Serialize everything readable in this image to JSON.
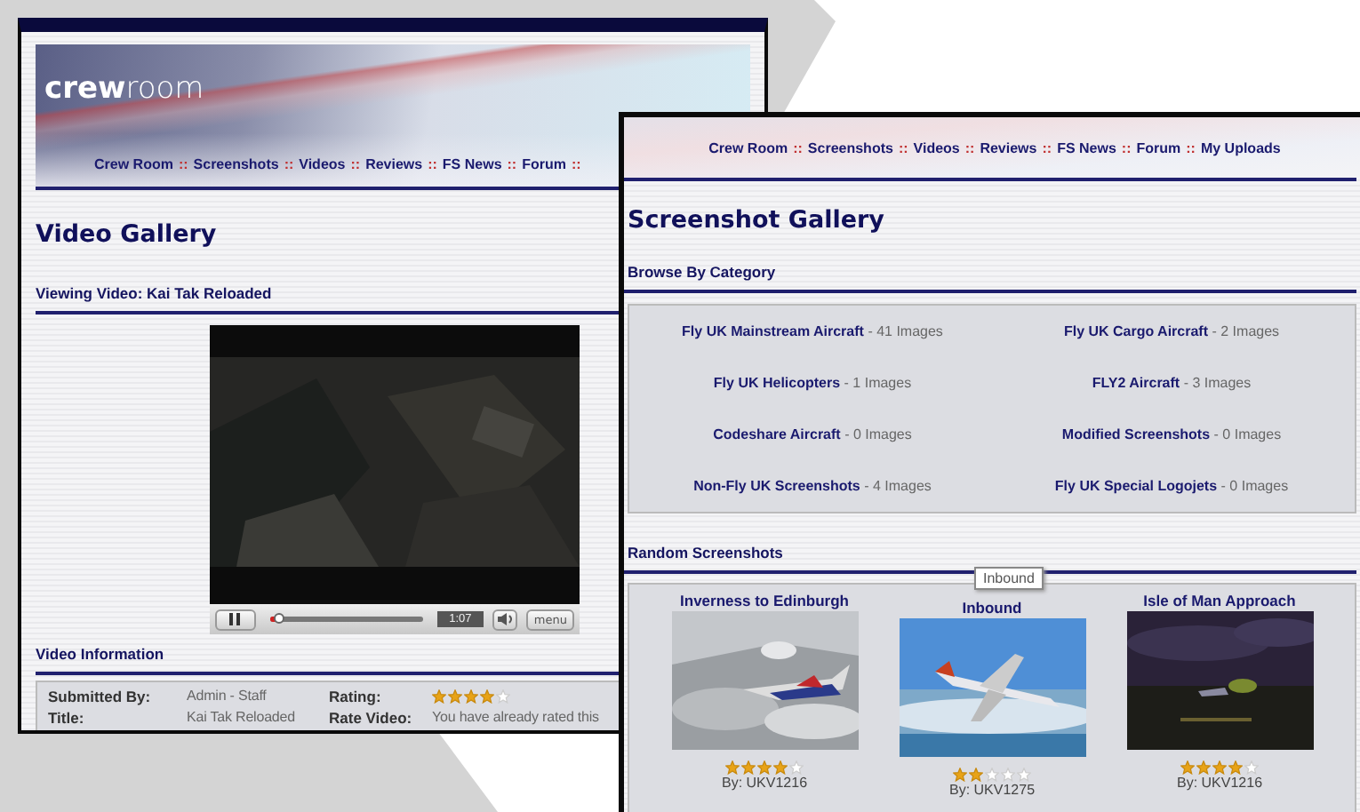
{
  "video_page": {
    "logo": "**crew**room",
    "nav": {
      "separator": "::",
      "items": [
        "Crew Room",
        "Screenshots",
        "Videos",
        "Reviews",
        "FS News",
        "Forum"
      ]
    },
    "title": "Video Gallery",
    "viewing_heading": "Viewing Video: Kai Tak Reloaded",
    "player": {
      "kind": "picture",
      "level": 0.08,
      "time": "1:07",
      "menu_button": "menu"
    },
    "info_heading": "Video Information",
    "info_fields": [
      {
        "label": "Submitted By:",
        "kind": "text",
        "value": "Admin - Staff"
      },
      {
        "label": "Rating:",
        "kind": "stars",
        "stars": 4
      },
      {
        "label": "Title:",
        "kind": "text",
        "value": "Kai Tak Reloaded"
      },
      {
        "label": "Rate Video:",
        "kind": "text",
        "value": "You have already rated this"
      }
    ]
  },
  "screenshot_page": {
    "nav": {
      "separator": "::",
      "items": [
        "Crew Room",
        "Screenshots",
        "Videos",
        "Reviews",
        "FS News",
        "Forum",
        "My Uploads"
      ]
    },
    "title": "Screenshot Gallery",
    "browse_heading": "Browse By Category",
    "categories": [
      {
        "name": "Fly UK Mainstream Aircraft",
        "count": "- 41 Images"
      },
      {
        "name": "Fly UK Cargo Aircraft",
        "count": "- 2 Images"
      },
      {
        "name": "Fly UK Helicopters",
        "count": "- 1 Images"
      },
      {
        "name": "FLY2 Aircraft",
        "count": "- 3 Images"
      },
      {
        "name": "Codeshare Aircraft",
        "count": "- 0 Images"
      },
      {
        "name": "Modified Screenshots",
        "count": "- 0 Images"
      },
      {
        "name": "Non-Fly UK Screenshots",
        "count": "- 4 Images"
      },
      {
        "name": "Fly UK Special Logojets",
        "count": "- 0 Images"
      }
    ],
    "random_heading": "Random Screenshots",
    "tooltip": "Inbound",
    "screenshots": [
      {
        "title": "Inverness to Edinburgh",
        "stars": 4,
        "author": "By: UKV1216"
      },
      {
        "title": "Inbound",
        "stars": 2,
        "author": "By: UKV1275"
      },
      {
        "title": "Isle of Man Approach",
        "stars": 4,
        "author": "By: UKV1216"
      }
    ]
  }
}
